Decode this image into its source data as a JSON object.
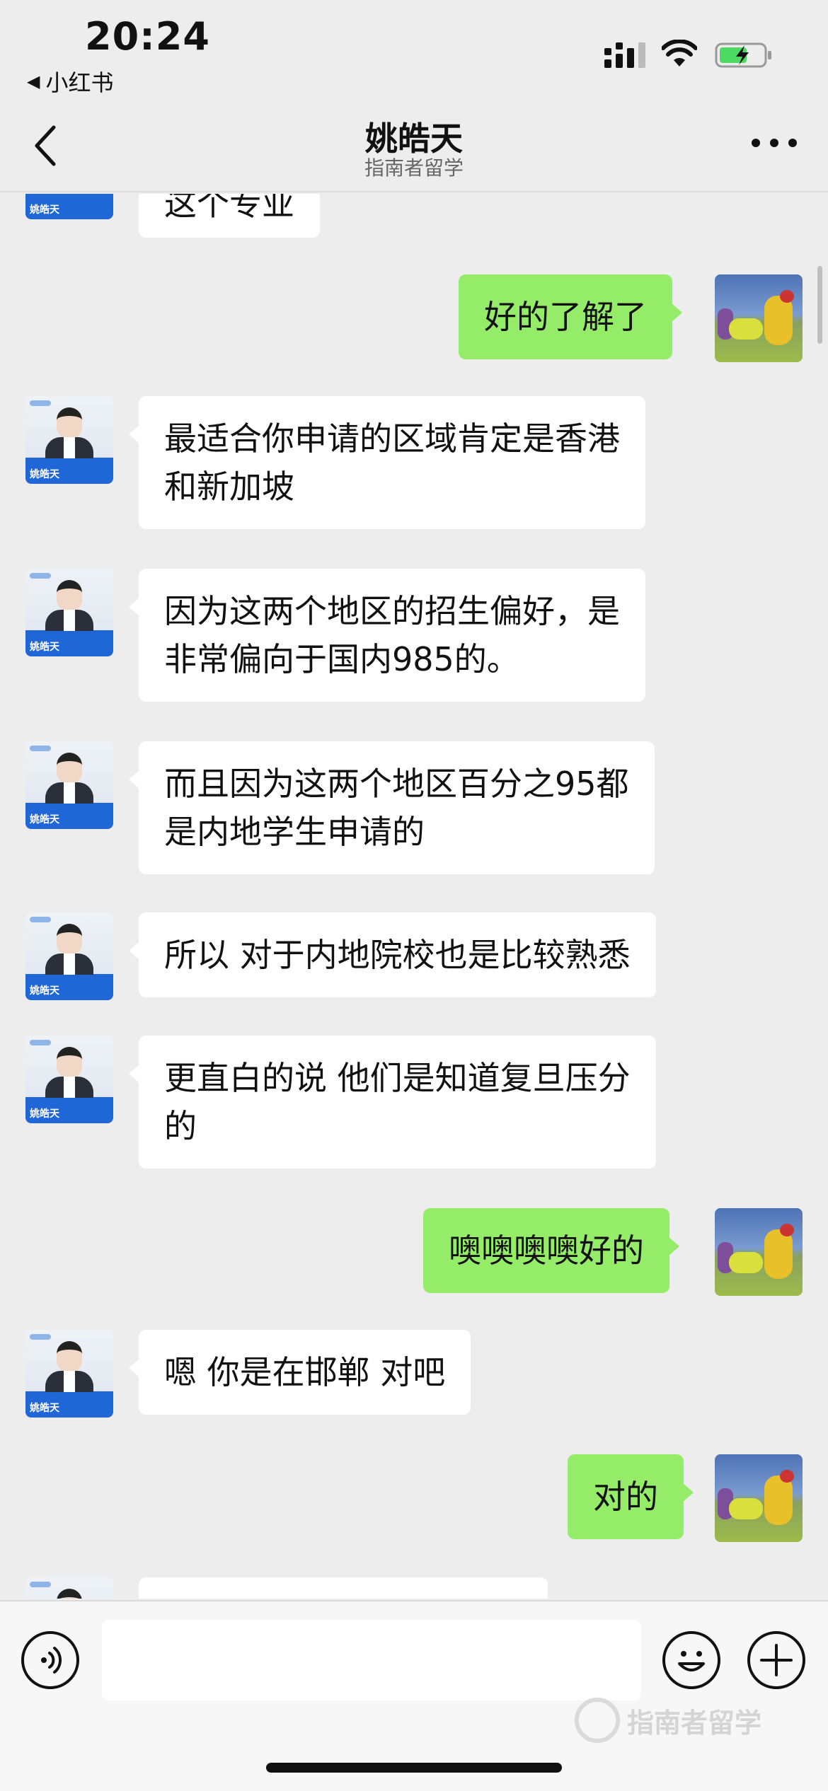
{
  "status_bar": {
    "time": "20:24",
    "back_app": "小红书"
  },
  "header": {
    "title": "姚皓天",
    "subtitle": "指南者留学"
  },
  "chat": {
    "partial_top": "这个专业",
    "agent_avatar_label": "姚皓天",
    "messages": [
      {
        "from": "me",
        "text": "好的了解了"
      },
      {
        "from": "agent",
        "text": "最适合你申请的区域肯定是香港\n和新加坡"
      },
      {
        "from": "agent",
        "text": "因为这两个地区的招生偏好，是\n非常偏向于国内985的。"
      },
      {
        "from": "agent",
        "text": "而且因为这两个地区百分之95都\n是内地学生申请的"
      },
      {
        "from": "agent",
        "text": "所以 对于内地院校也是比较熟悉"
      },
      {
        "from": "agent",
        "text": "更直白的说 他们是知道复旦压分\n的"
      },
      {
        "from": "me",
        "text": "噢噢噢噢好的"
      },
      {
        "from": "agent",
        "text": "嗯 你是在邯郸 对吧"
      },
      {
        "from": "me",
        "text": "对的"
      }
    ]
  },
  "input_bar": {
    "value": "",
    "watermark": "指南者留学"
  },
  "colors": {
    "background": "#ededed",
    "out_bubble": "#95ec69",
    "in_bubble": "#ffffff",
    "battery_charging": "#4cd964"
  }
}
